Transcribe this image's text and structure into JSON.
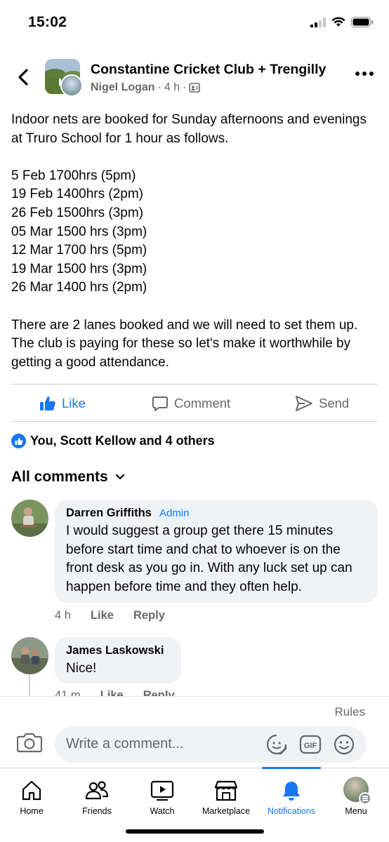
{
  "status_bar": {
    "time": "15:02"
  },
  "post": {
    "group_name": "Constantine Cricket Club + Trengilly",
    "author": "Nigel Logan",
    "time": "4 h",
    "body": [
      "Indoor nets are  booked for Sunday afternoons and evenings at Truro School for 1 hour as follows.",
      "",
      "5 Feb 1700hrs (5pm)",
      "19 Feb 1400hrs (2pm)",
      "26 Feb 1500hrs (3pm)",
      "05 Mar 1500 hrs (3pm)",
      "12 Mar 1700 hrs (5pm)",
      "19 Mar 1500 hrs (3pm)",
      "26 Mar 1400 hrs (2pm)",
      "",
      "There are 2 lanes booked and we will need to set them up. The club is paying for these so let's make it worthwhile by getting a good attendance."
    ]
  },
  "actions": {
    "like": "Like",
    "comment": "Comment",
    "send": "Send"
  },
  "reactions": {
    "text": "You, Scott Kellow and 4 others"
  },
  "comments_header": {
    "label": "All comments"
  },
  "comments": [
    {
      "author": "Darren Griffiths",
      "badge": "Admin",
      "text": "I would suggest a group get there 15 minutes before start time and chat to whoever is on the front desk as you go in. With any luck set up can happen before time and they often help.",
      "time": "4 h",
      "like": "Like",
      "reply": "Reply"
    },
    {
      "author": "James Laskowski",
      "text": "Nice!",
      "time": "41 m",
      "like": "Like",
      "reply": "Reply"
    }
  ],
  "composer": {
    "rules": "Rules",
    "placeholder": "Write a comment...",
    "gif": "GIF"
  },
  "tabs": [
    {
      "label": "Home",
      "icon": "home-icon"
    },
    {
      "label": "Friends",
      "icon": "friends-icon"
    },
    {
      "label": "Watch",
      "icon": "watch-icon"
    },
    {
      "label": "Marketplace",
      "icon": "marketplace-icon"
    },
    {
      "label": "Notifications",
      "icon": "bell-icon",
      "active": true
    },
    {
      "label": "Menu",
      "icon": "profile-avatar"
    }
  ],
  "colors": {
    "accent": "#1877f2",
    "secondary_text": "#65676b",
    "bubble": "#f0f2f5"
  }
}
